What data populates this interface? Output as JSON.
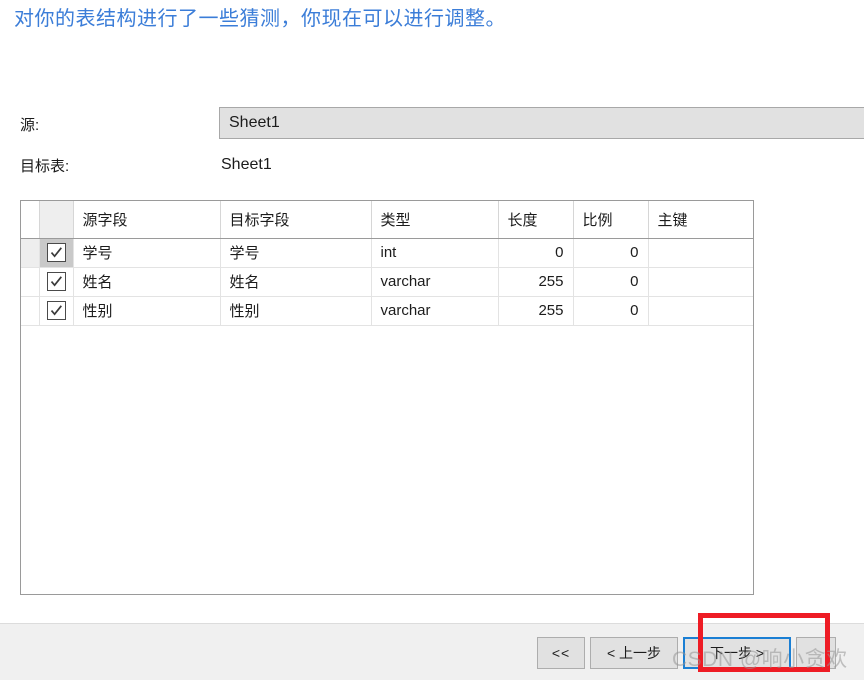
{
  "header": {
    "hint": "对你的表结构进行了一些猜测，你现在可以进行调整。",
    "hint_color": "#3b7dd8"
  },
  "fields": {
    "source_label": "源:",
    "source_value": "Sheet1",
    "target_label": "目标表:",
    "target_value": "Sheet1"
  },
  "grid": {
    "columns": [
      "源字段",
      "目标字段",
      "类型",
      "长度",
      "比例",
      "主键"
    ],
    "rows": [
      {
        "checked": true,
        "selected": true,
        "source_field": "学号",
        "target_field": "学号",
        "type": "int",
        "length": "0",
        "scale": "0",
        "primary_key": ""
      },
      {
        "checked": true,
        "selected": false,
        "source_field": "姓名",
        "target_field": "姓名",
        "type": "varchar",
        "length": "255",
        "scale": "0",
        "primary_key": ""
      },
      {
        "checked": true,
        "selected": false,
        "source_field": "性别",
        "target_field": "性别",
        "type": "varchar",
        "length": "255",
        "scale": "0",
        "primary_key": ""
      }
    ]
  },
  "footer": {
    "first_label": "<<",
    "prev_label": "< 上一步",
    "next_label": "下一步 >",
    "tail_label": "",
    "focus_color": "#1a7fd4"
  },
  "annotation": {
    "color": "#ee1c25"
  },
  "watermark": {
    "text": "CSDN @响小贪欢"
  }
}
